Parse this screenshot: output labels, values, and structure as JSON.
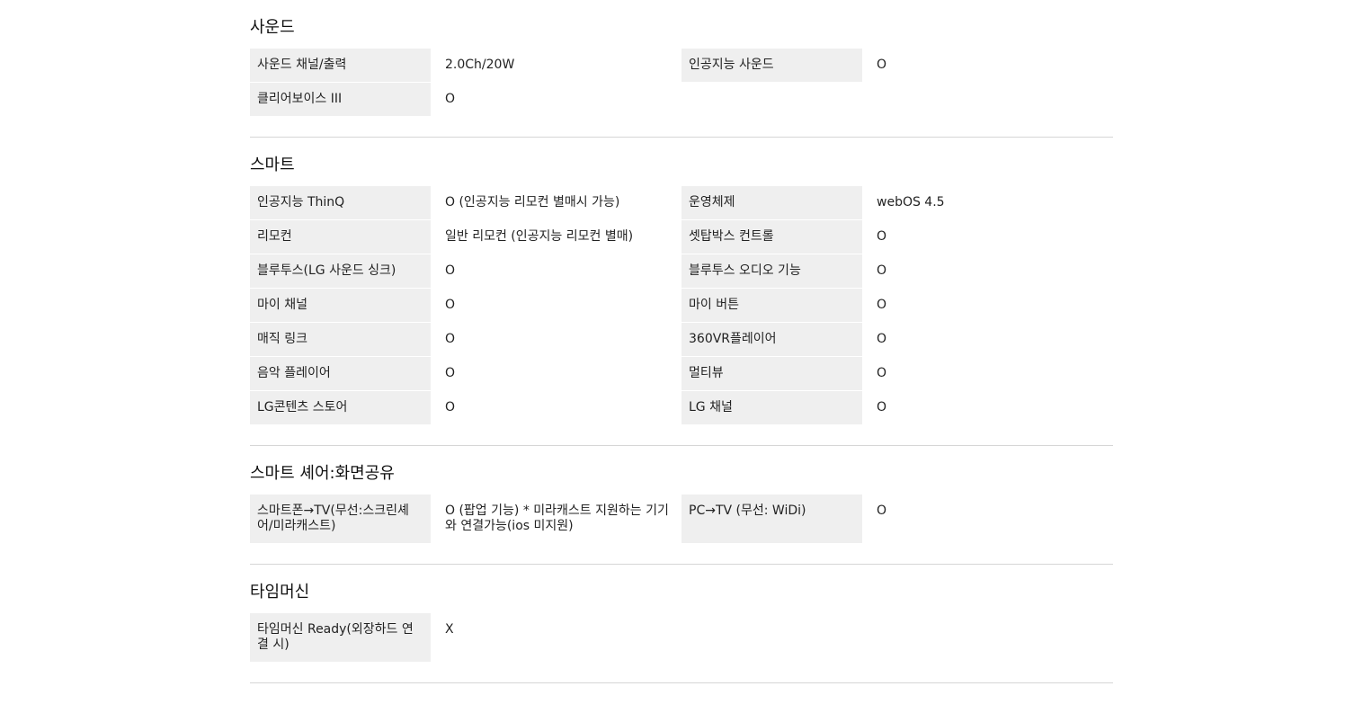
{
  "sections": [
    {
      "title": "사운드",
      "rows": [
        [
          "사운드 채널/출력",
          "2.0Ch/20W",
          "인공지능 사운드",
          "O"
        ],
        [
          "클리어보이스 III",
          "O",
          "",
          ""
        ]
      ]
    },
    {
      "title": "스마트",
      "rows": [
        [
          "인공지능 ThinQ",
          "O (인공지능 리모컨 별매시 가능)",
          "운영체제",
          "webOS 4.5"
        ],
        [
          "리모컨",
          "일반 리모컨 (인공지능 리모컨 별매)",
          "셋탑박스 컨트롤",
          "O"
        ],
        [
          "블루투스(LG 사운드 싱크)",
          "O",
          "블루투스 오디오 기능",
          "O"
        ],
        [
          "마이 채널",
          "O",
          "마이 버튼",
          "O"
        ],
        [
          "매직 링크",
          "O",
          "360VR플레이어",
          "O"
        ],
        [
          "음악 플레이어",
          "O",
          "멀티뷰",
          "O"
        ],
        [
          "LG콘텐츠 스토어",
          "O",
          "LG 채널",
          "O"
        ]
      ]
    },
    {
      "title": "스마트 셰어:화면공유",
      "rows": [
        [
          "스마트폰→TV(무선:스크린셰어/미라캐스트)",
          "O (팝업 기능) * 미라캐스트 지원하는 기기와 연결가능(ios 미지원)",
          "PC→TV (무선: WiDi)",
          "O"
        ]
      ]
    },
    {
      "title": "타임머신",
      "rows": [
        [
          "타임머신 Ready(외장하드 연결 시)",
          "X",
          "",
          ""
        ]
      ]
    }
  ]
}
